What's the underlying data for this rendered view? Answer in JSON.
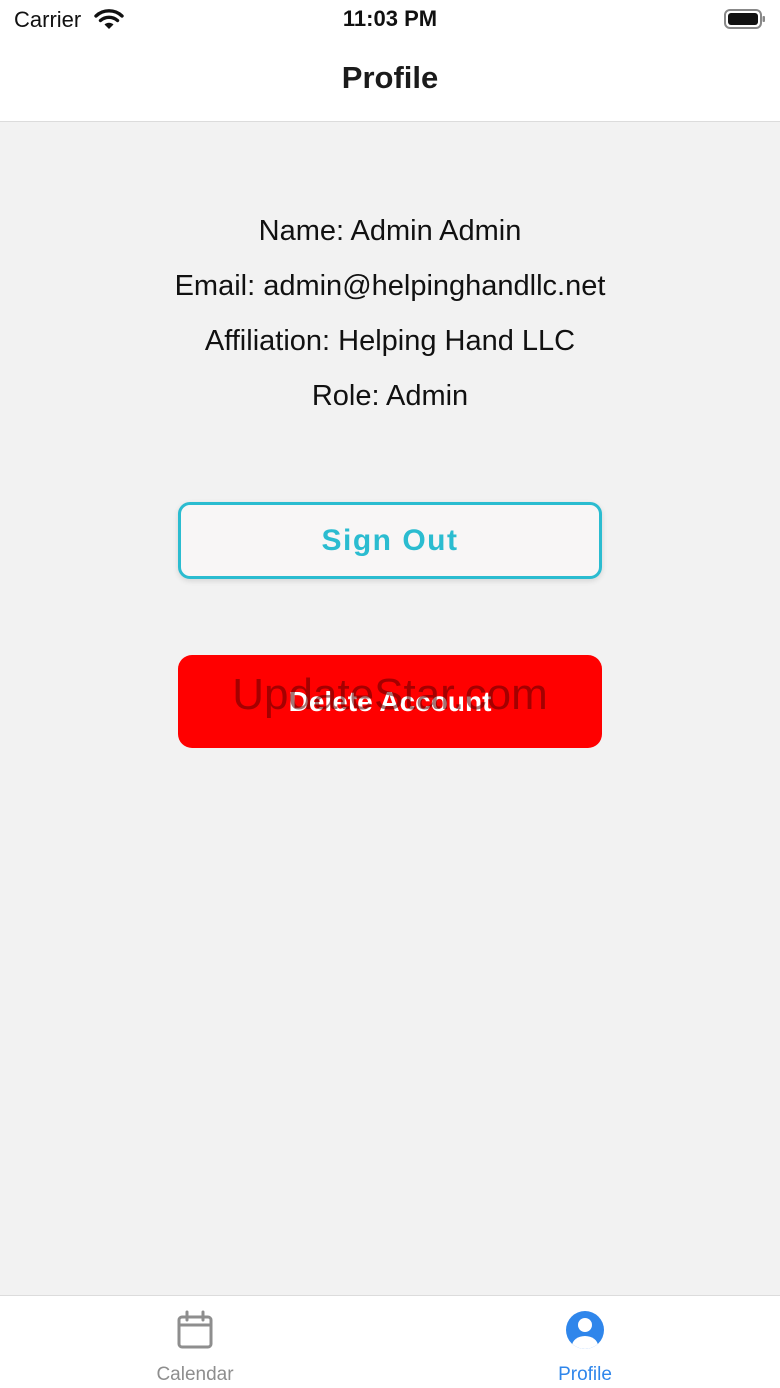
{
  "status_bar": {
    "carrier": "Carrier",
    "time": "11:03 PM"
  },
  "nav": {
    "title": "Profile"
  },
  "profile": {
    "name_label": "Name: ",
    "name_value": "Admin Admin",
    "email_label": "Email: ",
    "email_value": "admin@helpinghandllc.net",
    "affiliation_label": "Affiliation: ",
    "affiliation_value": "Helping Hand LLC",
    "role_label": "Role: ",
    "role_value": "Admin"
  },
  "actions": {
    "sign_out_label": "Sign Out",
    "delete_label": "Delete Account"
  },
  "watermark": "UpdateStar.com",
  "tab_bar": {
    "tabs": [
      {
        "label": "Calendar",
        "icon": "calendar-icon",
        "active": false
      },
      {
        "label": "Profile",
        "icon": "user-circle-icon",
        "active": true
      }
    ]
  },
  "colors": {
    "accent": "#2bbcd0",
    "danger": "#ff0000",
    "tab_active": "#2f86eb",
    "tab_inactive": "#8e8e8e",
    "background": "#f2f2f2"
  }
}
